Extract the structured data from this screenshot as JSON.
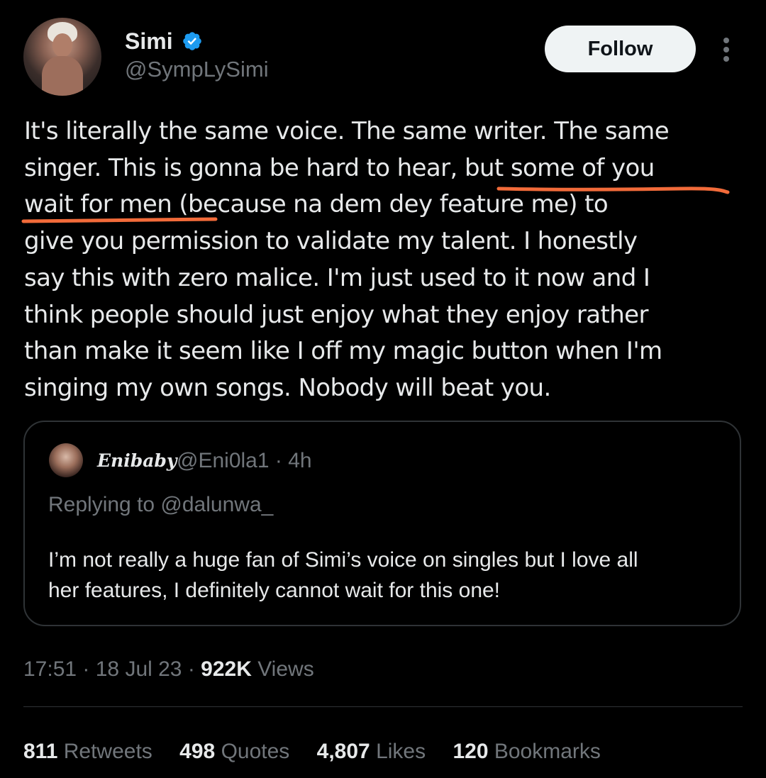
{
  "author": {
    "name": "Simi",
    "handle": "@SympLySimi",
    "follow_label": "Follow",
    "verified_badge_icon": "verified-check-icon",
    "verified_color": "#1d9bf0"
  },
  "tweet": {
    "lines": [
      "It's literally the same voice. The same writer. The same",
      "singer. This is gonna be hard to hear, but some of you",
      "wait for men (because na dem dey feature me) to",
      "give you permission to validate my talent. I honestly",
      "say this with zero malice. I'm just used to it now and I",
      "think people should just enjoy what they enjoy rather",
      "than make it seem like I off my magic button when I'm",
      "singing my own songs. Nobody will beat you."
    ],
    "annotation_color": "#f26b3a"
  },
  "quote": {
    "name": "Enibaby",
    "handle_time": "@Eni0la1 · 4h",
    "replying_to": "Replying to @dalunwa_",
    "lines": [
      "I’m not really a huge fan of Simi’s voice on singles but I love all",
      "her features, I definitely cannot wait for this one!"
    ]
  },
  "meta": {
    "time_date": "17:51 · 18 Jul 23 · ",
    "views_count": "922K",
    "views_label": " Views"
  },
  "stats": [
    {
      "count": "811",
      "label": "Retweets"
    },
    {
      "count": "498",
      "label": "Quotes"
    },
    {
      "count": "4,807",
      "label": "Likes"
    },
    {
      "count": "120",
      "label": "Bookmarks"
    }
  ]
}
